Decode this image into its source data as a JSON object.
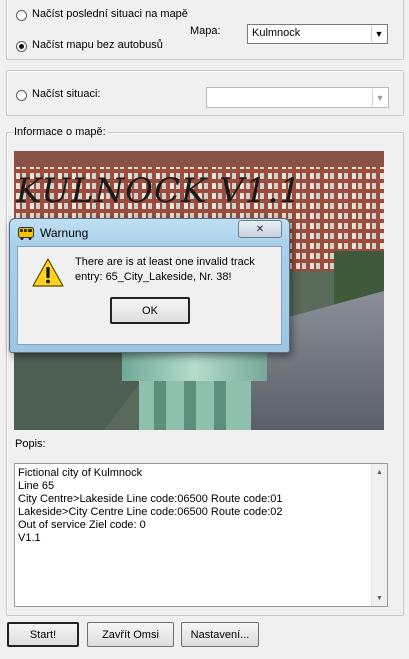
{
  "options_group": {
    "radio_last_situation": "Načíst poslední situaci na mapě",
    "radio_map_no_buses": "Načíst mapu bez autobusů",
    "map_label": "Mapa:",
    "map_value": "Kulmnock"
  },
  "situation_group": {
    "radio_load_situation": "Načíst situaci:",
    "situation_value": ""
  },
  "map_info": {
    "group_label": "Informace o mapě:",
    "banner_text": "KULNOCK V1.1",
    "description_label": "Popis:",
    "description_lines": [
      "Fictional city of Kulmnock",
      "Line 65",
      "City Centre>Lakeside Line code:06500 Route code:01",
      "Lakeside>City Centre Line code:06500 Route code:02",
      "Out of service Ziel code: 0",
      "V1.1"
    ]
  },
  "buttons": {
    "start": "Start!",
    "close": "Zavřít Omsi",
    "settings": "Nastavení..."
  },
  "dialog": {
    "title": "Warnung",
    "message_line1": "There are is at least one invalid track",
    "message_line2": "entry: 65_City_Lakeside, Nr. 38!",
    "ok_label": "OK",
    "close_glyph": "✕",
    "icon": "warning-icon",
    "title_icon": "bus-icon"
  },
  "icons": {
    "dropdown": "▼",
    "scroll_up": "▲",
    "scroll_down": "▼"
  }
}
